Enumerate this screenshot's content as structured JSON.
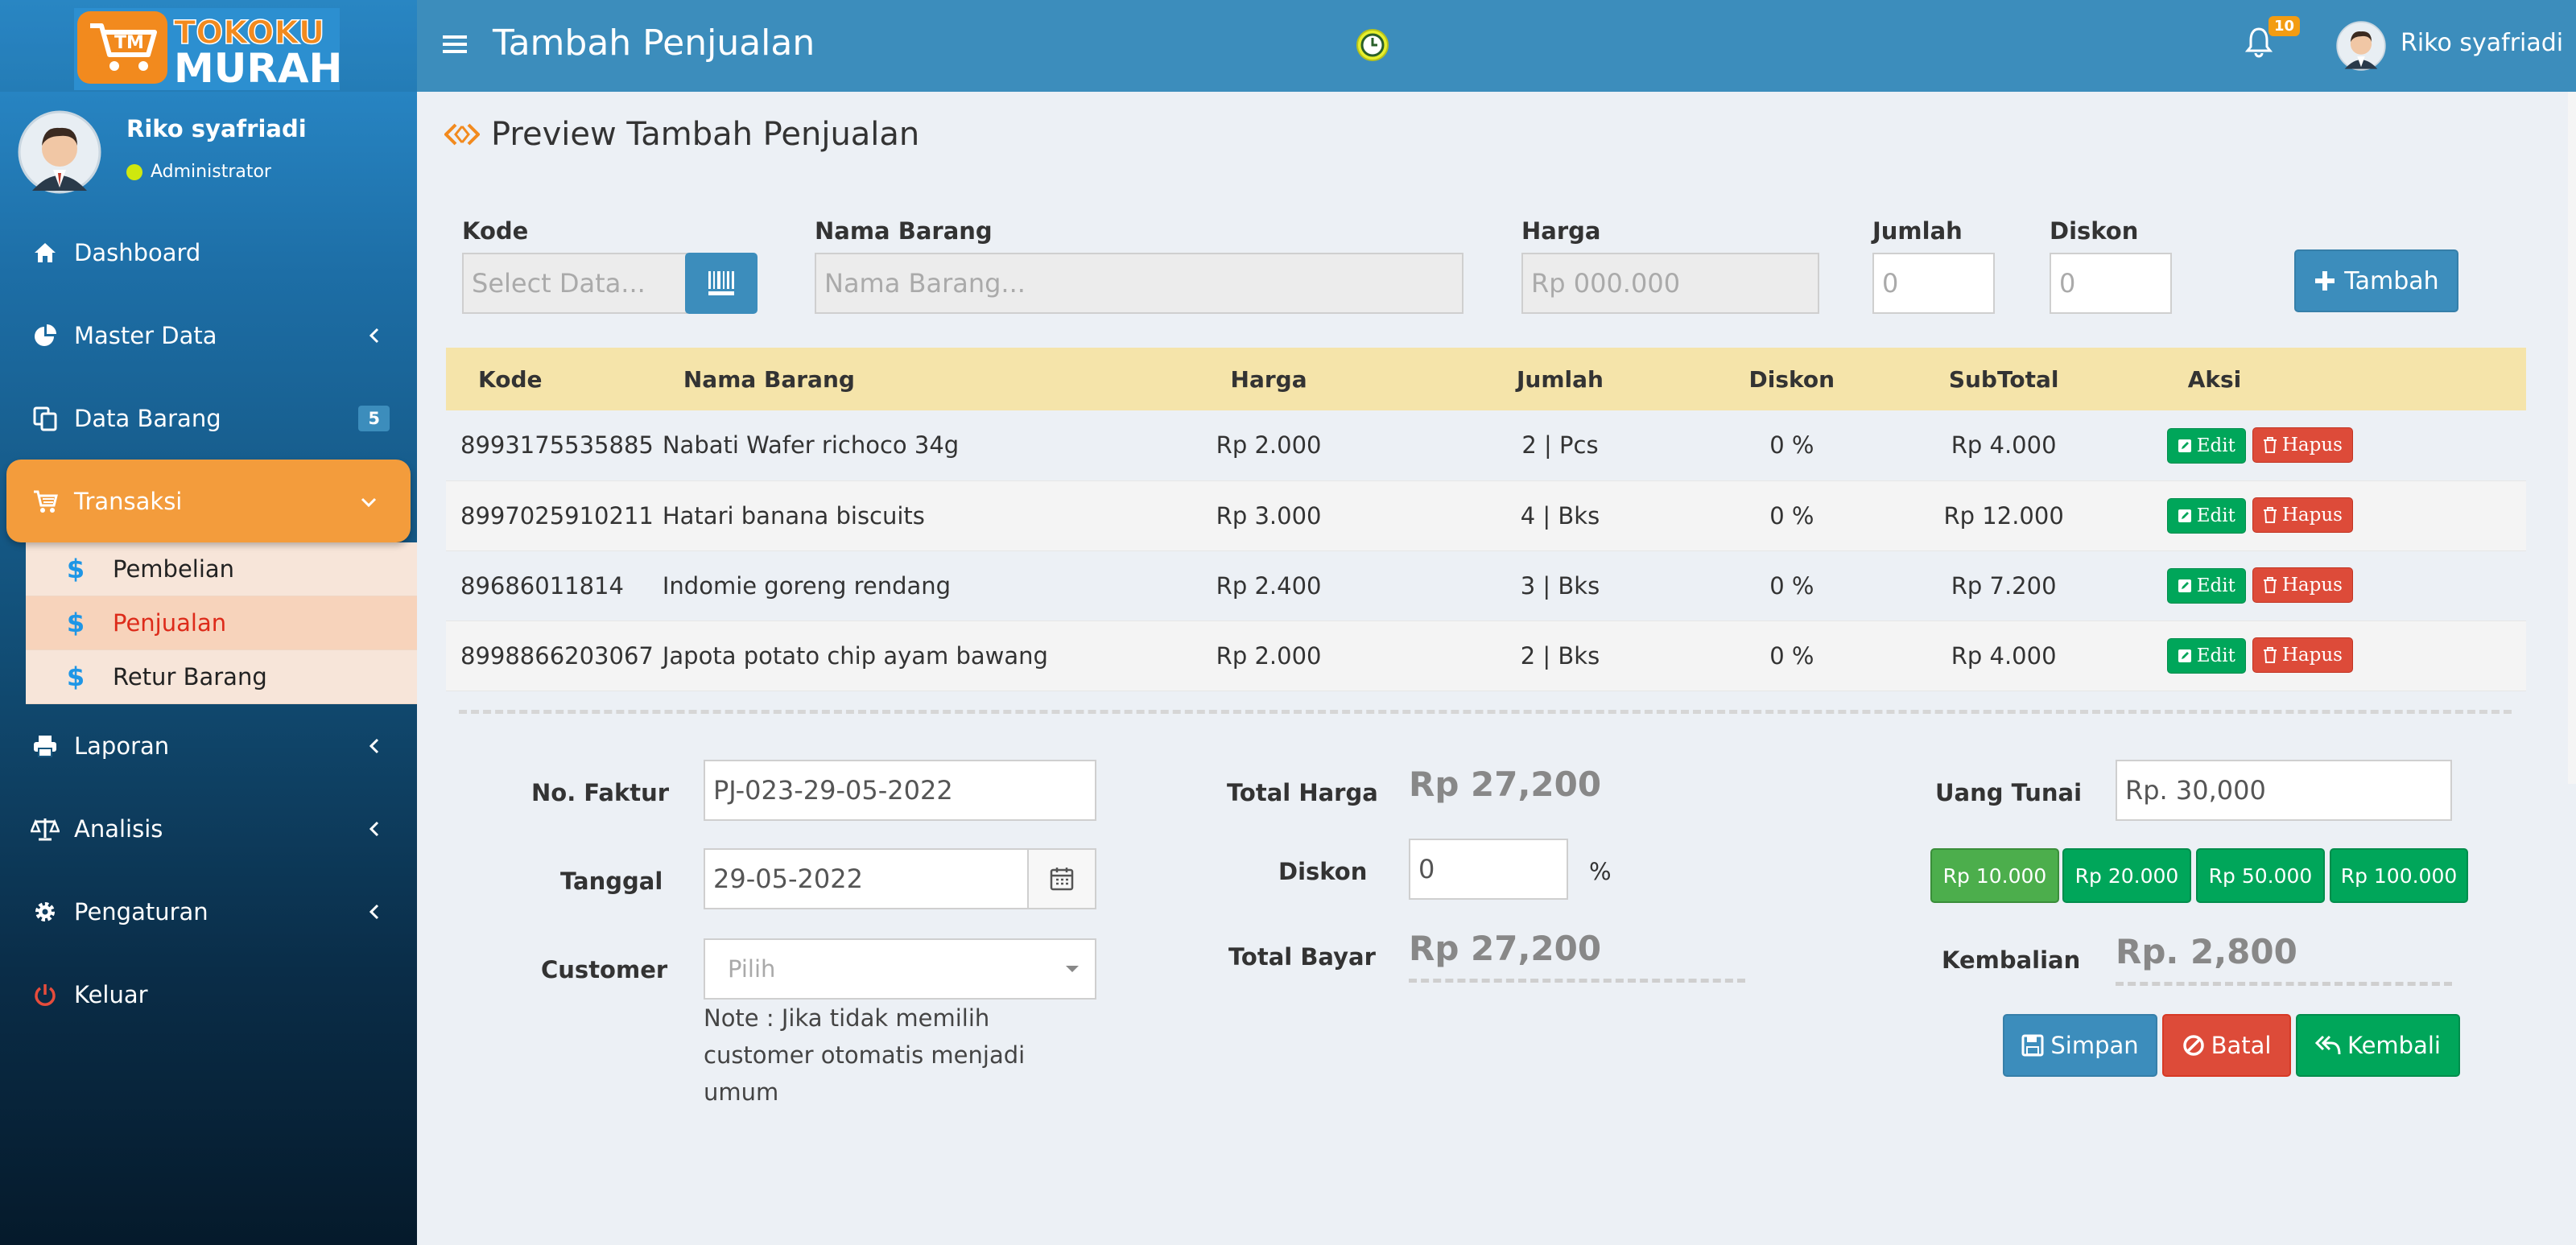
{
  "brand": {
    "line1": "TOKOKU",
    "line2": "MURAH",
    "mark": "TM"
  },
  "sidebar": {
    "user": {
      "name": "Riko syafriadi",
      "role": "Administrator"
    },
    "items": [
      {
        "label": "Dashboard",
        "icon": "home-icon"
      },
      {
        "label": "Master Data",
        "icon": "pie-chart-icon"
      },
      {
        "label": "Data Barang",
        "icon": "copy-icon",
        "count": "5"
      },
      {
        "label": "Transaksi",
        "icon": "cart-icon"
      },
      {
        "label": "Laporan",
        "icon": "print-icon"
      },
      {
        "label": "Analisis",
        "icon": "balance-scale-icon"
      },
      {
        "label": "Pengaturan",
        "icon": "gear-icon"
      },
      {
        "label": "Keluar",
        "icon": "power-icon"
      }
    ],
    "submenu": [
      {
        "label": "Pembelian",
        "icon": "$"
      },
      {
        "label": "Penjualan",
        "icon": "$"
      },
      {
        "label": "Retur Barang",
        "icon": "$"
      }
    ]
  },
  "header": {
    "title": "Tambah Penjualan",
    "notif_count": "10",
    "user_name": "Riko syafriadi"
  },
  "main": {
    "title": "Preview Tambah Penjualan",
    "form": {
      "kode_label": "Kode",
      "kode_placeholder": "Select Data...",
      "nama_label": "Nama Barang",
      "nama_placeholder": "Nama Barang...",
      "harga_label": "Harga",
      "harga_placeholder": "Rp 000.000",
      "jumlah_label": "Jumlah",
      "jumlah_placeholder": "0",
      "diskon_label": "Diskon",
      "diskon_placeholder": "0",
      "tambah_label": "Tambah"
    },
    "table": {
      "headers": [
        "Kode",
        "Nama  Barang",
        "Harga",
        "Jumlah",
        "Diskon",
        "SubTotal",
        "Aksi"
      ],
      "rows": [
        {
          "kode": "8993175535885",
          "nama": "Nabati Wafer richoco 34g",
          "harga": "Rp 2.000",
          "jumlah": "2 | Pcs",
          "diskon": "0 %",
          "subtotal": "Rp 4.000"
        },
        {
          "kode": "8997025910211",
          "nama": "Hatari banana biscuits",
          "harga": "Rp 3.000",
          "jumlah": "4 | Bks",
          "diskon": "0 %",
          "subtotal": "Rp 12.000"
        },
        {
          "kode": "89686011814",
          "nama": "Indomie goreng rendang",
          "harga": "Rp 2.400",
          "jumlah": "3 | Bks",
          "diskon": "0 %",
          "subtotal": "Rp 7.200"
        },
        {
          "kode": "8998866203067",
          "nama": "Japota potato chip ayam bawang",
          "harga": "Rp 2.000",
          "jumlah": "2 | Bks",
          "diskon": "0 %",
          "subtotal": "Rp 4.000"
        }
      ],
      "edit_label": "Edit",
      "hapus_label": "Hapus"
    },
    "bottom": {
      "faktur_label": "No. Faktur",
      "faktur_value": "PJ-023-29-05-2022",
      "tanggal_label": "Tanggal",
      "tanggal_value": "29-05-2022",
      "customer_label": "Customer",
      "customer_placeholder": "Pilih",
      "note": "Note : Jika tidak memilih customer otomatis menjadi umum",
      "total_harga_label": "Total Harga",
      "total_harga_value": "Rp 27,200",
      "diskon_label": "Diskon",
      "diskon_value": "0",
      "percent": "%",
      "total_bayar_label": "Total Bayar",
      "total_bayar_value": "Rp 27,200",
      "uang_tunai_label": "Uang Tunai",
      "uang_tunai_value": "Rp. 30,000",
      "quick_amounts": [
        "Rp 10.000",
        "Rp 20.000",
        "Rp 50.000",
        "Rp 100.000"
      ],
      "kembalian_label": "Kembalian",
      "kembalian_value": "Rp. 2,800",
      "simpan_label": "Simpan",
      "batal_label": "Batal",
      "kembali_label": "Kembali"
    }
  },
  "colors": {
    "header": "#3c8dbc",
    "active_menu": "#f39c3c",
    "table_header": "#f5e4aa",
    "green": "#00a65a",
    "red": "#dd4b39",
    "blue": "#3c8dbc"
  }
}
